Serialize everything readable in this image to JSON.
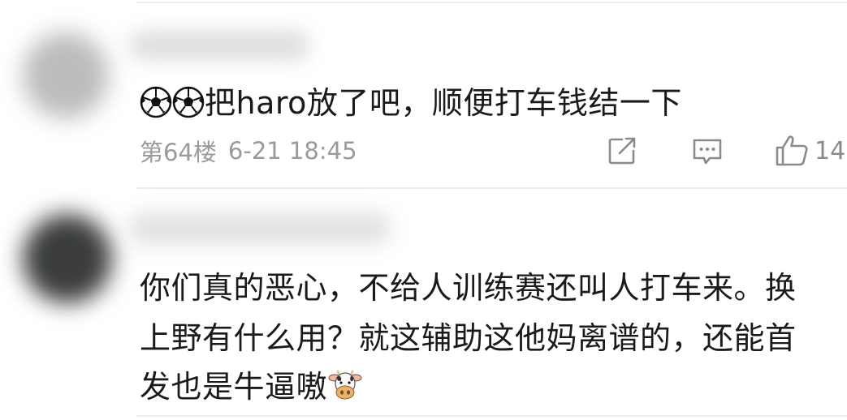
{
  "comments": [
    {
      "text": "把haro放了吧，顺便打车钱结一下",
      "leading_emojis": [
        "soccer-ball-icon",
        "soccer-ball-icon"
      ],
      "floor": "第64楼",
      "timestamp": "6-21 18:45",
      "actions": {
        "share_icon": "share-icon",
        "reply_icon": "reply-icon",
        "like_icon": "like-icon",
        "like_count": "14"
      }
    },
    {
      "lines": [
        "你们真的恶心，不给人训练赛还叫人打车来。换",
        "上野有什么用？就这辅助这他妈离谱的，还能首",
        "发也是牛逼嗷"
      ],
      "trailing_emoji": "cow-face-icon"
    }
  ],
  "colors": {
    "text": "#1a1a1a",
    "meta": "#9a9a9a",
    "divider": "#ededed"
  }
}
